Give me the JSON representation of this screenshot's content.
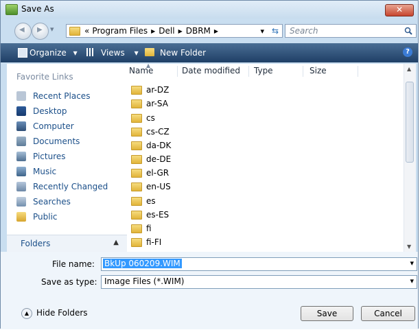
{
  "window": {
    "title": "Save As",
    "close_glyph": "✕"
  },
  "nav": {
    "back_glyph": "◀",
    "forward_glyph": "▶",
    "history_glyph": "▾",
    "path_prefix": "«",
    "breadcrumb": [
      "Program Files",
      "Dell",
      "DBRM"
    ],
    "sep_glyph": "▶",
    "dropdown_glyph": "▾",
    "refresh_glyph": "⇆",
    "search_placeholder": "Search"
  },
  "toolbar": {
    "organize": "Organize",
    "views": "Views",
    "new_folder": "New Folder",
    "help_glyph": "?",
    "menu_glyph": "▾"
  },
  "favorites": {
    "title": "Favorite Links",
    "items": [
      "Recent Places",
      "Desktop",
      "Computer",
      "Documents",
      "Pictures",
      "Music",
      "Recently Changed",
      "Searches",
      "Public"
    ]
  },
  "folders_toggle": {
    "label": "Folders",
    "chevron_glyph": "▲"
  },
  "columns": {
    "name": "Name",
    "date_modified": "Date modified",
    "type": "Type",
    "size": "Size"
  },
  "files": [
    "ar-DZ",
    "ar-SA",
    "cs",
    "cs-CZ",
    "da-DK",
    "de-DE",
    "el-GR",
    "en-US",
    "es",
    "es-ES",
    "fi",
    "fi-FI"
  ],
  "form": {
    "file_name_label": "File name:",
    "file_name_value": "BkUp 060209.WIM",
    "save_type_label": "Save as type:",
    "save_type_value": "Image Files (*.WIM)",
    "dropdown_glyph": "▾"
  },
  "footer": {
    "hide_folders": "Hide Folders",
    "hide_glyph": "▲",
    "save": "Save",
    "cancel": "Cancel"
  },
  "colors": {
    "accent": "#1b4f89",
    "toolbar": "#2a4a70",
    "selection": "#3399ff"
  }
}
